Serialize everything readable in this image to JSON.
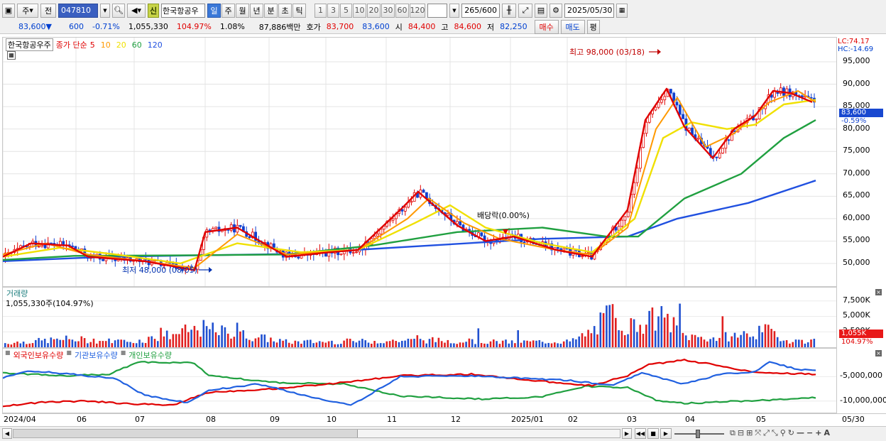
{
  "toolbar": {
    "menu_1": "주",
    "menu_2": "전",
    "code": "047810",
    "name": "한국항공우",
    "badge": "신",
    "periods": [
      "일",
      "주",
      "월",
      "년",
      "분",
      "초",
      "틱"
    ],
    "active_period": "일",
    "intervals": [
      "1",
      "3",
      "5",
      "10",
      "20",
      "30",
      "60",
      "120"
    ],
    "count_value": "265",
    "count_total": "/600",
    "date": "2025/05/30"
  },
  "quote": {
    "price": "83,600",
    "arrow": "▼",
    "change": "600",
    "change_pct": "-0.71%",
    "volume": "1,055,330",
    "vol_ratio": "104.97%",
    "turnover": "1.08%",
    "amount": "87,886백만",
    "ask_label": "호가",
    "ask": "83,700",
    "bid": "83,600",
    "open_label": "시",
    "open": "84,400",
    "high_label": "고",
    "high": "84,600",
    "low_label": "저",
    "low": "82,250",
    "buy": "매수",
    "sell": "매도",
    "eval": "평"
  },
  "price_panel": {
    "legend_name": "한국항공우주",
    "legend_type": "종가 단순",
    "ma_periods": [
      "5",
      "10",
      "20",
      "60",
      "120"
    ],
    "ma_colors": [
      "#e00000",
      "#ff9900",
      "#f0e000",
      "#20a040",
      "#2050e0"
    ],
    "high_annotation": "최고 98,000 (03/18)",
    "low_annotation": "최저 48,000 (08/05)",
    "dividend_annotation": "배당락(0.00%)",
    "lc": "LC:74.17",
    "hc": "HC:-14.69",
    "current_price": "83,600",
    "current_pct": "-0.59%",
    "y_ticks": [
      "95,000",
      "90,000",
      "85,000",
      "80,000",
      "75,000",
      "70,000",
      "65,000",
      "60,000",
      "55,000",
      "50,000"
    ]
  },
  "volume_panel": {
    "title": "거래량",
    "value": "1,055,330주(104.97%)",
    "y_ticks": [
      "7,500K",
      "5,000K",
      "2,500K"
    ],
    "current": "1,055K",
    "current_pct": "104.97%"
  },
  "holdings_panel": {
    "series": [
      "외국인보유수량",
      "기관보유수량",
      "개인보유수량"
    ],
    "series_colors": [
      "#e00000",
      "#2060e0",
      "#20a040"
    ],
    "y_ticks": [
      "-5,000,000",
      "-10,000,000"
    ]
  },
  "x_axis": [
    "2024/04",
    "06",
    "07",
    "08",
    "09",
    "10",
    "11",
    "12",
    "2025/01",
    "02",
    "03",
    "04",
    "05",
    "05/30"
  ],
  "chart_data": {
    "type": "candlestick",
    "x_range": [
      "2024/04",
      "2025/05/30"
    ],
    "ylim": [
      47000,
      98500
    ],
    "ma_nodes": {
      "ma5": [
        [
          0,
          51500
        ],
        [
          40,
          54500
        ],
        [
          92,
          54000
        ],
        [
          120,
          51500
        ],
        [
          200,
          50500
        ],
        [
          270,
          48500
        ],
        [
          285,
          57000
        ],
        [
          330,
          58000
        ],
        [
          400,
          51500
        ],
        [
          460,
          52500
        ],
        [
          500,
          53000
        ],
        [
          560,
          62000
        ],
        [
          585,
          66000
        ],
        [
          640,
          58500
        ],
        [
          680,
          55000
        ],
        [
          720,
          56000
        ],
        [
          780,
          53000
        ],
        [
          830,
          51500
        ],
        [
          880,
          62000
        ],
        [
          905,
          82000
        ],
        [
          935,
          89000
        ],
        [
          960,
          80500
        ],
        [
          1000,
          73500
        ],
        [
          1030,
          80000
        ],
        [
          1060,
          83000
        ],
        [
          1085,
          88500
        ],
        [
          1110,
          88000
        ],
        [
          1140,
          86000
        ]
      ],
      "ma10": [
        [
          0,
          52000
        ],
        [
          60,
          54500
        ],
        [
          120,
          52000
        ],
        [
          200,
          50500
        ],
        [
          270,
          49000
        ],
        [
          330,
          56500
        ],
        [
          400,
          52000
        ],
        [
          500,
          53000
        ],
        [
          570,
          60000
        ],
        [
          600,
          64500
        ],
        [
          650,
          59000
        ],
        [
          700,
          55500
        ],
        [
          780,
          53000
        ],
        [
          830,
          52000
        ],
        [
          880,
          58000
        ],
        [
          920,
          80000
        ],
        [
          950,
          87000
        ],
        [
          990,
          76000
        ],
        [
          1030,
          79000
        ],
        [
          1080,
          86000
        ],
        [
          1120,
          88500
        ],
        [
          1145,
          86000
        ]
      ],
      "ma20": [
        [
          0,
          51500
        ],
        [
          80,
          53500
        ],
        [
          160,
          52000
        ],
        [
          250,
          50000
        ],
        [
          330,
          54500
        ],
        [
          420,
          52500
        ],
        [
          500,
          53000
        ],
        [
          580,
          59000
        ],
        [
          630,
          63000
        ],
        [
          680,
          58000
        ],
        [
          760,
          54500
        ],
        [
          830,
          52500
        ],
        [
          890,
          60000
        ],
        [
          930,
          78000
        ],
        [
          970,
          81500
        ],
        [
          1020,
          80000
        ],
        [
          1060,
          81000
        ],
        [
          1100,
          85500
        ],
        [
          1145,
          86500
        ]
      ],
      "ma60": [
        [
          0,
          50800
        ],
        [
          100,
          51700
        ],
        [
          250,
          51800
        ],
        [
          400,
          52000
        ],
        [
          520,
          54000
        ],
        [
          640,
          57000
        ],
        [
          760,
          58000
        ],
        [
          850,
          56000
        ],
        [
          895,
          56000
        ],
        [
          960,
          64500
        ],
        [
          1040,
          70000
        ],
        [
          1100,
          78000
        ],
        [
          1145,
          82000
        ]
      ],
      "ma120": [
        [
          0,
          50500
        ],
        [
          150,
          51500
        ],
        [
          400,
          52100
        ],
        [
          600,
          54000
        ],
        [
          760,
          55500
        ],
        [
          880,
          56000
        ],
        [
          950,
          60000
        ],
        [
          1050,
          63500
        ],
        [
          1145,
          68500
        ]
      ]
    },
    "volume_nodes_k": [
      [
        0,
        700
      ],
      [
        90,
        1400
      ],
      [
        180,
        900
      ],
      [
        280,
        3200
      ],
      [
        400,
        900
      ],
      [
        500,
        1000
      ],
      [
        540,
        1100
      ],
      [
        600,
        1200
      ],
      [
        700,
        900
      ],
      [
        800,
        1000
      ],
      [
        830,
        2800
      ],
      [
        855,
        5800
      ],
      [
        880,
        3400
      ],
      [
        895,
        4200
      ],
      [
        930,
        5100
      ],
      [
        960,
        1900
      ],
      [
        1000,
        1500
      ],
      [
        1080,
        2800
      ],
      [
        1100,
        1200
      ],
      [
        1145,
        1055
      ]
    ],
    "holdings_nodes": {
      "foreign": [
        [
          0,
          -11000000
        ],
        [
          60,
          -10200000
        ],
        [
          120,
          -10000000
        ],
        [
          180,
          -10600000
        ],
        [
          240,
          -10800000
        ],
        [
          290,
          -8200000
        ],
        [
          380,
          -7500000
        ],
        [
          480,
          -6200000
        ],
        [
          560,
          -4800000
        ],
        [
          660,
          -4500000
        ],
        [
          740,
          -5700000
        ],
        [
          830,
          -6800000
        ],
        [
          880,
          -4800000
        ],
        [
          910,
          -2500000
        ],
        [
          960,
          -1600000
        ],
        [
          1000,
          -2500000
        ],
        [
          1060,
          -4100000
        ],
        [
          1145,
          -4500000
        ]
      ],
      "institution": [
        [
          0,
          -5200000
        ],
        [
          40,
          -3800000
        ],
        [
          100,
          -4500000
        ],
        [
          160,
          -5500000
        ],
        [
          200,
          -8800000
        ],
        [
          260,
          -10300000
        ],
        [
          290,
          -7800000
        ],
        [
          360,
          -6500000
        ],
        [
          420,
          -8700000
        ],
        [
          490,
          -10900000
        ],
        [
          560,
          -5000000
        ],
        [
          640,
          -4800000
        ],
        [
          720,
          -5200000
        ],
        [
          800,
          -5800000
        ],
        [
          860,
          -6800000
        ],
        [
          900,
          -4200000
        ],
        [
          960,
          -6500000
        ],
        [
          1010,
          -4500000
        ],
        [
          1060,
          -4000000
        ],
        [
          1080,
          -2000000
        ],
        [
          1120,
          -3500000
        ],
        [
          1145,
          -3700000
        ]
      ],
      "individual": [
        [
          0,
          -4200000
        ],
        [
          80,
          -4800000
        ],
        [
          150,
          -4500000
        ],
        [
          190,
          -2000000
        ],
        [
          270,
          -2200000
        ],
        [
          290,
          -4700000
        ],
        [
          380,
          -6200000
        ],
        [
          480,
          -6500000
        ],
        [
          560,
          -9000000
        ],
        [
          680,
          -9600000
        ],
        [
          760,
          -9100000
        ],
        [
          820,
          -7000000
        ],
        [
          880,
          -7200000
        ],
        [
          920,
          -9800000
        ],
        [
          960,
          -10500000
        ],
        [
          1040,
          -10000000
        ],
        [
          1100,
          -9700000
        ],
        [
          1145,
          -9300000
        ]
      ]
    }
  }
}
